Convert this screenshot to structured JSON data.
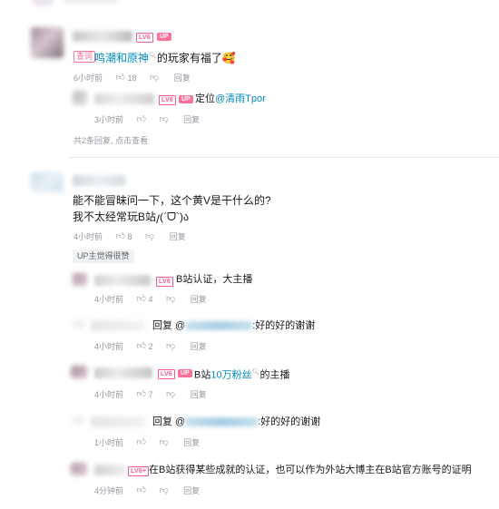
{
  "comments": [
    {
      "level": "LV6",
      "up": "UP",
      "search_tag": "查词",
      "content_link": "鸣潮和原神",
      "content_suffix": "的玩家有福了",
      "emoji": "🥰",
      "time": "6小时前",
      "likes": "18",
      "reply_label": "回复",
      "reply": {
        "level": "LV6",
        "up": "UP",
        "content_prefix": "定位",
        "mention": "@清雨Tpor",
        "time": "3小时前",
        "reply_label": "回复"
      },
      "more": "共2条回复, 点击查看"
    },
    {
      "content_line1": "能不能冒昧问一下，这个黄V是干什么的?",
      "content_line2": "我不太经常玩B站𐑢(ˊᗜˋ)ა",
      "time": "4小时前",
      "likes": "8",
      "reply_label": "回复",
      "up_tag": "UP主觉得很赞",
      "replies": [
        {
          "level": "LV6",
          "content": "B站认证，大主播",
          "time": "4小时前",
          "likes": "4",
          "reply_label": "回复"
        },
        {
          "level": "",
          "content_prefix": "回复 @",
          "content_suffix": ":好的好的谢谢",
          "time": "4小时前",
          "likes": "2",
          "reply_label": "回复"
        },
        {
          "level": "LV6",
          "up": "UP",
          "content_prefix": "B站",
          "content_link": "10万粉丝",
          "content_suffix": "的主播",
          "time": "4小时前",
          "likes": "7",
          "reply_label": "回复"
        },
        {
          "level": "",
          "content_prefix": "回复 @",
          "content_suffix": ":好的好的谢谢",
          "time": "1小时前",
          "likes": "",
          "reply_label": "回复"
        },
        {
          "level": "LV6+",
          "content": "在B站获得某些成就的认证，也可以作为外站大博主在B站官方账号的证明",
          "time": "4分钟前",
          "likes": "",
          "reply_label": "回复"
        }
      ]
    }
  ],
  "icons": {
    "like": "thumbs-up-icon",
    "dislike": "thumbs-down-icon",
    "search": "search-icon"
  },
  "colors": {
    "accent_pink": "#fb7299",
    "link_blue": "#008ac5",
    "meta_gray": "#9499a0"
  }
}
